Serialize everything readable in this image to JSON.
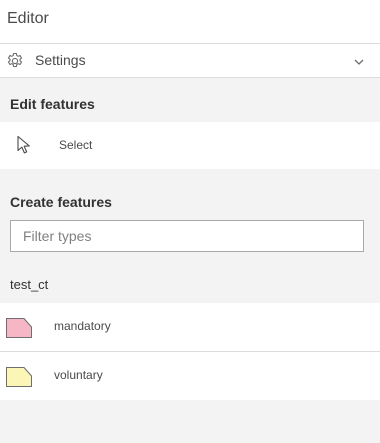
{
  "header": {
    "title": "Editor"
  },
  "settings": {
    "label": "Settings",
    "icon": "gear-icon",
    "expand_icon": "chevron-down-icon"
  },
  "edit_features": {
    "heading": "Edit features",
    "select": {
      "label": "Select",
      "icon": "cursor-arrow-icon"
    }
  },
  "create_features": {
    "heading": "Create features",
    "filter": {
      "placeholder": "Filter types",
      "value": ""
    },
    "layer": {
      "name": "test_ct",
      "templates": [
        {
          "label": "mandatory",
          "fill": "#f7b6c6",
          "stroke": "#6e6e6e"
        },
        {
          "label": "voluntary",
          "fill": "#fbf6b6",
          "stroke": "#6e6e6e"
        }
      ]
    }
  }
}
